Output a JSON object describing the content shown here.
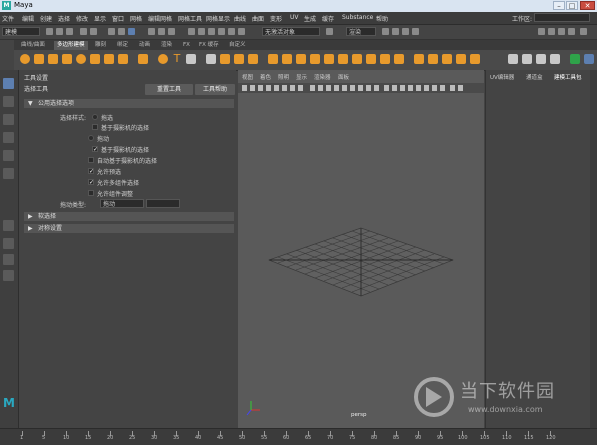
{
  "window": {
    "title": "Maya",
    "logo": "M",
    "min": "–",
    "max": "□",
    "close": "✕"
  },
  "menubar": {
    "items": [
      "文件",
      "编辑",
      "创建",
      "选择",
      "修改",
      "显示",
      "窗口",
      "网格",
      "编辑网格",
      "网格工具",
      "网格显示",
      "曲线",
      "曲面",
      "变形",
      "UV",
      "生成",
      "缓存",
      "Substance",
      "帮助"
    ],
    "workspace_label": "工作区:"
  },
  "statusline": {
    "mode": "建模",
    "selection_field": "无激活对象",
    "render_field": "渲染"
  },
  "shelf": {
    "tabs": [
      "曲线/曲面",
      "多边形建模",
      "雕刻",
      "绑定",
      "动画",
      "渲染",
      "FX",
      "FX 缓存",
      "自定义"
    ]
  },
  "toolpanel": {
    "header": "工具设置",
    "tool_name": "选择工具",
    "reset_button": "重置工具",
    "help_button": "工具帮助",
    "sections": [
      "公用选择选项",
      "软选择",
      "对称设置"
    ],
    "options": {
      "select_by_label": "选择样式:",
      "marquee": "拖选",
      "camera_based": "基于摄影机的选择",
      "drag": "拖动",
      "camera_based_2": "基于摄影机的选择",
      "auto_camera": "自动基于摄影机的选择",
      "preselect_highlight": "允许预选",
      "select_by_component": "允许多组件选择",
      "tweak_mode": "允许组件调整",
      "drag_label": "拖动类型:",
      "drag_value": "拖动"
    }
  },
  "viewport": {
    "menus": [
      "视图",
      "着色",
      "照明",
      "显示",
      "渲染器",
      "面板"
    ],
    "camera": "persp"
  },
  "rightpanel": {
    "tabs": [
      "UV编辑器",
      "通道盒",
      "建模工具包"
    ]
  },
  "timeline": {
    "ticks": [
      "1",
      "5",
      "10",
      "15",
      "20",
      "25",
      "30",
      "35",
      "40",
      "45",
      "50",
      "55",
      "60",
      "65",
      "70",
      "75",
      "80",
      "85",
      "90",
      "95",
      "100",
      "105",
      "110",
      "115",
      "120"
    ]
  },
  "watermark": {
    "text": "当下软件园",
    "url": "www.downxia.com"
  },
  "colors": {
    "accent": "#5d7fb0",
    "shelf_orange": "#e89a2c",
    "maya_logo": "#2aa8c0"
  }
}
